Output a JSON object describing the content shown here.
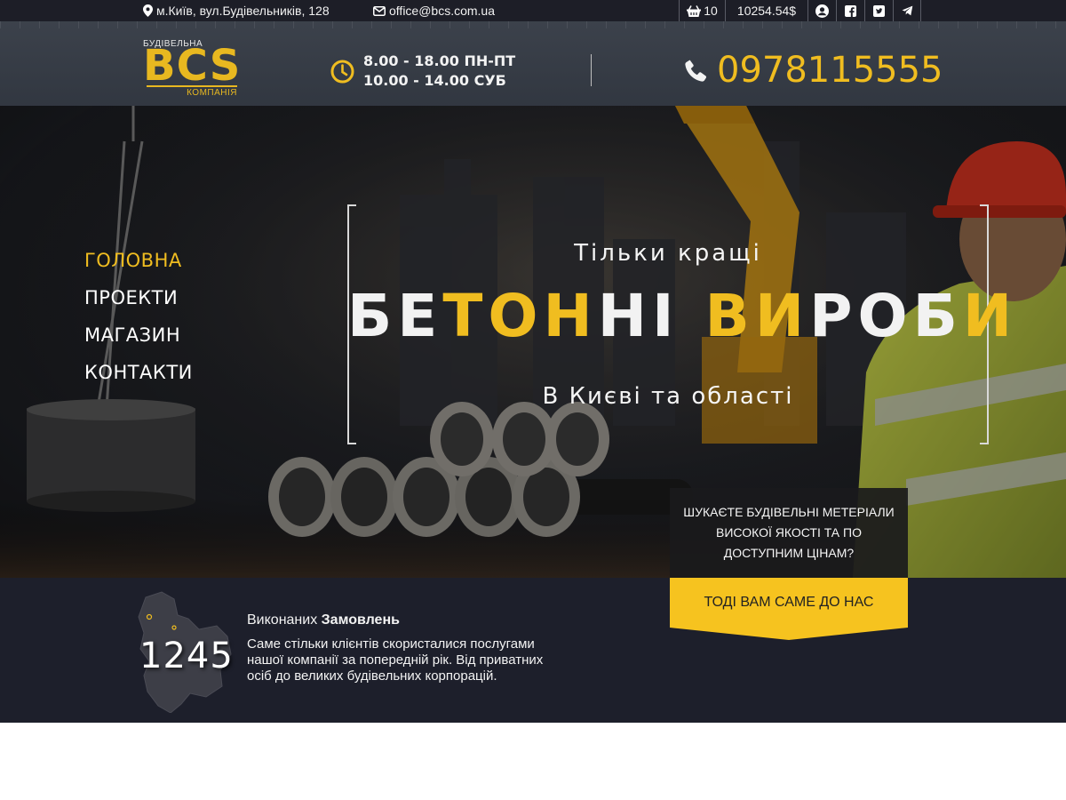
{
  "topbar": {
    "address": "м.Київ, вул.Будівельників, 128",
    "email": "office@bcs.com.ua",
    "cart_count": "10",
    "cart_total": "10254.54$"
  },
  "header": {
    "logo": {
      "top": "БУДІВЕЛЬНА",
      "main": "BCS",
      "bottom": "КОМПАНІЯ"
    },
    "hours_weekdays": "8.00 - 18.00 ПН-ПТ",
    "hours_saturday": "10.00 - 14.00 СУБ",
    "phone": "0978115555"
  },
  "nav": {
    "items": [
      {
        "label": "ГОЛОВНА",
        "active": true
      },
      {
        "label": "ПРОЕКТИ",
        "active": false
      },
      {
        "label": "МАГАЗИН",
        "active": false
      },
      {
        "label": "КОНТАКТИ",
        "active": false
      }
    ]
  },
  "hero": {
    "subtitle": "Тільки кращі",
    "title_parts": [
      "БЕ",
      "ТОН",
      "НІ ",
      "ВИ",
      "Р",
      "ОБ",
      "И"
    ],
    "region": "В Києві та області",
    "promo_text": "ШУКАЄТЕ БУДІВЕЛЬНІ МЕТЕРІАЛИ ВИСОКОЇ ЯКОСТІ ТА ПО ДОСТУПНИМ ЦІНАМ?",
    "cta_label": "ТОДІ ВАМ САМЕ ДО НАС"
  },
  "stats": {
    "count": "1245",
    "title_normal": "Виконаних ",
    "title_bold": "Замовлень",
    "description": "Саме стільки клієнтів скористалися послугами нашої компанії за попередній рік. Від приватних осіб до великих будівельних корпорацій."
  },
  "colors": {
    "accent": "#f0bd20",
    "topbar_bg": "#1d1e27",
    "header_bg": "#343a44",
    "stats_bg": "#1d1f2b"
  },
  "icons": {
    "address": "map-marker-icon",
    "email": "envelope-icon",
    "cart": "basket-icon",
    "account": "user-circle-icon",
    "facebook": "facebook-icon",
    "twitter": "twitter-icon",
    "telegram": "telegram-icon",
    "hours": "clock-icon",
    "phone": "phone-icon"
  }
}
